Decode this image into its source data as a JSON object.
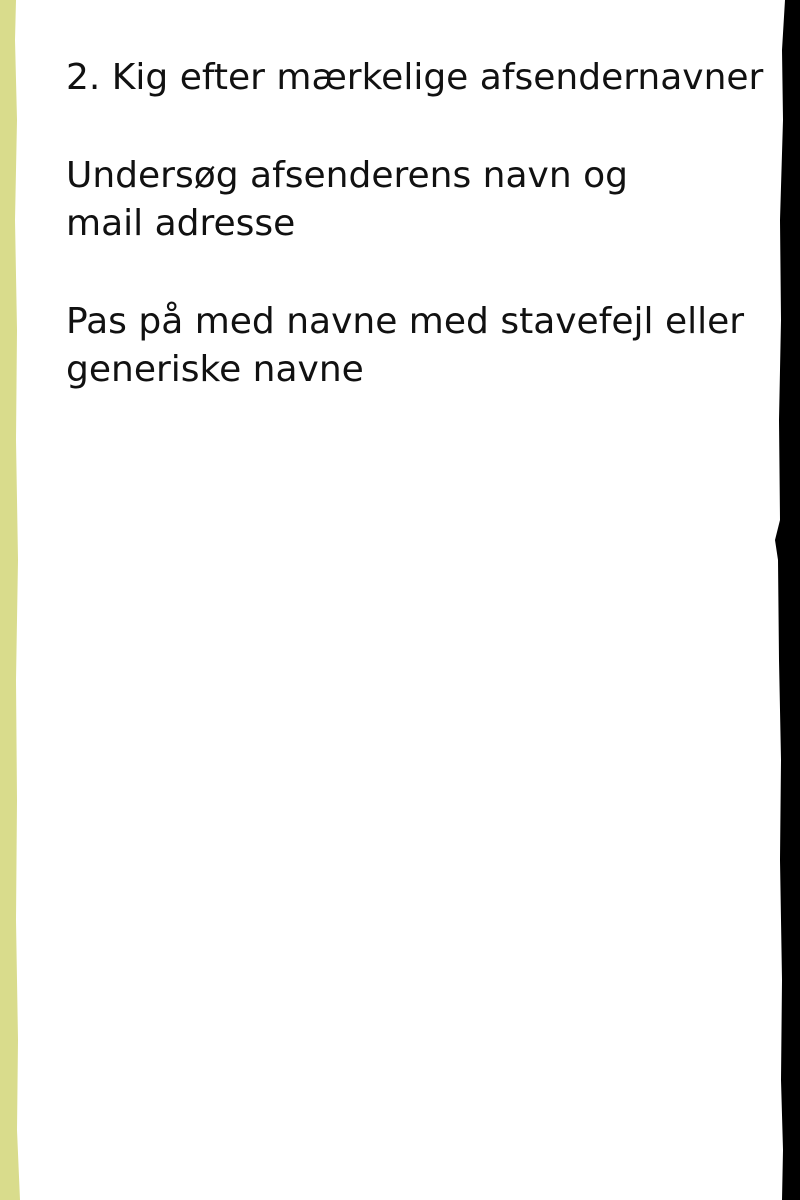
{
  "page": {
    "colors": {
      "background": "#ffffff",
      "left_border": "#d9dc8c",
      "right_border": "#000000",
      "text": "#111111"
    }
  },
  "slide": {
    "heading": "2. Kig efter mærkelige afsendernavner",
    "paragraph1": {
      "line1": "Undersøg afsenderens navn og",
      "line2": "mail adresse"
    },
    "paragraph2": {
      "line1": "Pas på med navne med stavefejl eller",
      "line2": "generiske navne"
    }
  }
}
